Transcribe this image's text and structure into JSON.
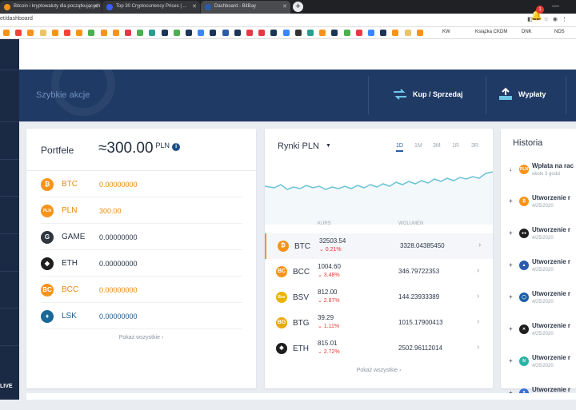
{
  "browser": {
    "tabs": [
      {
        "title": "Bitcoin i kryptowaluty dla początkujących",
        "favicon_color": "#f7931a"
      },
      {
        "title": "Top 30 Cryptocurrency Prices | ...",
        "favicon_color": "#3861fb"
      },
      {
        "title": "Dashboard - BitBay",
        "favicon_color": "#2a5cab"
      }
    ],
    "new_tab": "+",
    "url": "et/dashboard",
    "bookmark_labels": [
      "KW",
      "Książka CKDM",
      "DNK",
      "NDS"
    ]
  },
  "sidebar": {
    "live_label": "LIVE"
  },
  "topbar": {
    "notifications_count": "1"
  },
  "hero": {
    "title": "Szybkie akcje",
    "actions": [
      {
        "label": "Kup / Sprzedaj",
        "icon": "exchange-icon"
      },
      {
        "label": "Wypłaty",
        "icon": "withdraw-icon"
      }
    ]
  },
  "wallet": {
    "title": "Portfele",
    "total": "≈300.00",
    "total_currency": "PLN",
    "info": "i",
    "rows": [
      {
        "symbol": "BTC",
        "amount": "0.00000000",
        "color": "#f7931a",
        "text_color": "#e8890d",
        "glyph": "₿"
      },
      {
        "symbol": "PLN",
        "amount": "300.00",
        "color": "#f7931a",
        "text_color": "#e8890d",
        "glyph": "PLN"
      },
      {
        "symbol": "GAME",
        "amount": "0.00000000",
        "color": "#2f3640",
        "text_color": "#2d3748",
        "glyph": "G"
      },
      {
        "symbol": "ETH",
        "amount": "0.00000000",
        "color": "#1e1e1e",
        "text_color": "#1f2d3d",
        "glyph": "◆"
      },
      {
        "symbol": "BCC",
        "amount": "0.00000000",
        "color": "#f7931a",
        "text_color": "#e8890d",
        "glyph": "BC"
      },
      {
        "symbol": "LSK",
        "amount": "0.00000000",
        "color": "#1a6896",
        "text_color": "#1d5c8f",
        "glyph": "♦"
      }
    ],
    "show_all": "Pokaż wszystkie ›"
  },
  "markets": {
    "title": "Rynki PLN",
    "timeframes": [
      "1D",
      "1M",
      "3M",
      "1R",
      "3R"
    ],
    "active_timeframe": "1D",
    "col_rate": "KURS",
    "col_volume": "WOLUMEN",
    "rows": [
      {
        "symbol": "BTC",
        "price": "32503.54",
        "change": "⌄ 0.21%",
        "volume": "3328.04385450",
        "color": "#f7931a",
        "glyph": "₿",
        "selected": true
      },
      {
        "symbol": "BCC",
        "price": "1004.60",
        "change": "⌄ 3.48%",
        "volume": "346.79722353",
        "color": "#f7931a",
        "glyph": "BC",
        "selected": false
      },
      {
        "symbol": "BSV",
        "price": "812.00",
        "change": "⌄ 2.87%",
        "volume": "144.23933389",
        "color": "#eab300",
        "glyph": "Bsv",
        "selected": false
      },
      {
        "symbol": "BTG",
        "price": "39.29",
        "change": "⌄ 1.11%",
        "volume": "1015.17900413",
        "color": "#eba809",
        "glyph": "BG",
        "selected": false
      },
      {
        "symbol": "ETH",
        "price": "815.01",
        "change": "⌄ 2.72%",
        "volume": "2502.96112014",
        "color": "#1e1e1e",
        "glyph": "◆",
        "selected": false
      }
    ],
    "show_all": "Pokaż wszystkie ›",
    "sparkline_color": "#6cc3d5"
  },
  "history": {
    "title": "Historia",
    "items": [
      {
        "title": "Wpłata na rac",
        "subtitle": "około 3 godzi",
        "color": "#f7931a",
        "glyph": "PLN",
        "arrow": "↓"
      },
      {
        "title": "Utworzenie r",
        "subtitle": "4/25/2020",
        "color": "#f7931a",
        "glyph": "₿",
        "arrow": "+"
      },
      {
        "title": "Utworzenie r",
        "subtitle": "4/25/2020",
        "color": "#1e1e1e",
        "glyph": "●●",
        "arrow": "+"
      },
      {
        "title": "Utworzenie r",
        "subtitle": "4/25/2020",
        "color": "#2a5cab",
        "glyph": "▲",
        "arrow": "+"
      },
      {
        "title": "Utworzenie r",
        "subtitle": "4/25/2020",
        "color": "#1b5fa8",
        "glyph": "◯",
        "arrow": "+"
      },
      {
        "title": "Utworzenie r",
        "subtitle": "4/25/2020",
        "color": "#1e1e1e",
        "glyph": "✕",
        "arrow": "+"
      },
      {
        "title": "Utworzenie r",
        "subtitle": "4/25/2020",
        "color": "#2bb3a6",
        "glyph": "N",
        "arrow": "+"
      },
      {
        "title": "Utworzenie r",
        "subtitle": "4/25/2020",
        "color": "#3b6fd6",
        "glyph": "$",
        "arrow": "+"
      }
    ]
  }
}
